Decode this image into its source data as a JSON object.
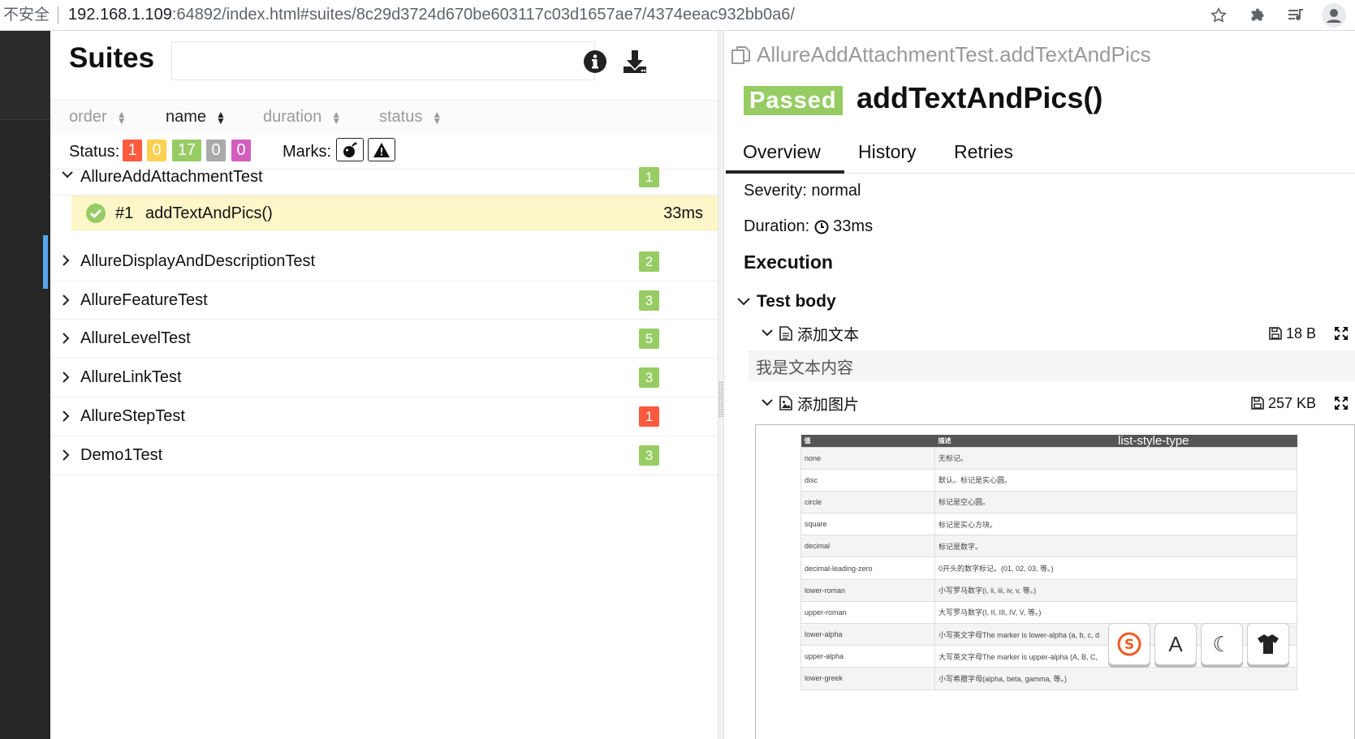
{
  "browser": {
    "insecure_label": "不安全",
    "url_host": "192.168.1.109",
    "url_path": ":64892/index.html#suites/8c29d3724d670be603117c03d1657ae7/4374eeac932bb0a6/"
  },
  "suites": {
    "title": "Suites",
    "search_placeholder": "",
    "sort": {
      "order": "order",
      "name": "name",
      "duration": "duration",
      "status": "status"
    },
    "status_label": "Status:",
    "status_counts": [
      {
        "value": "1",
        "color": "#fd5a3e"
      },
      {
        "value": "0",
        "color": "#ffd050"
      },
      {
        "value": "17",
        "color": "#97cc64"
      },
      {
        "value": "0",
        "color": "#aaaaaa"
      },
      {
        "value": "0",
        "color": "#d35ebe"
      }
    ],
    "marks_label": "Marks:",
    "groups": [
      {
        "name": "AllureAddAttachmentTest",
        "count": "1",
        "color": "#97cc64",
        "expanded": true
      },
      {
        "name": "AllureDisplayAndDescriptionTest",
        "count": "2",
        "color": "#97cc64"
      },
      {
        "name": "AllureFeatureTest",
        "count": "3",
        "color": "#97cc64"
      },
      {
        "name": "AllureLevelTest",
        "count": "5",
        "color": "#97cc64"
      },
      {
        "name": "AllureLinkTest",
        "count": "3",
        "color": "#97cc64"
      },
      {
        "name": "AllureStepTest",
        "count": "1",
        "color": "#fd5a3e"
      },
      {
        "name": "Demo1Test",
        "count": "3",
        "color": "#97cc64"
      }
    ],
    "test": {
      "num": "#1",
      "name": "addTextAndPics()",
      "duration": "33ms"
    }
  },
  "detail": {
    "path": "AllureAddAttachmentTest.addTextAndPics",
    "status": "Passed",
    "title": "addTextAndPics()",
    "tabs": [
      "Overview",
      "History",
      "Retries"
    ],
    "severity": "Severity: normal",
    "duration_label": "Duration:",
    "duration_value": "33ms",
    "execution": "Execution",
    "test_body": "Test body",
    "attachments": [
      {
        "name": "添加文本",
        "size": "18 B",
        "content": "我是文本内容"
      },
      {
        "name": "添加图片",
        "size": "257 KB"
      }
    ],
    "image_table": {
      "header": [
        "值",
        "描述"
      ],
      "caption": "list-style-type",
      "rows": [
        [
          "none",
          "无标记。"
        ],
        [
          "disc",
          "默认。标记是实心圆。"
        ],
        [
          "circle",
          "标记是空心圆。"
        ],
        [
          "square",
          "标记是实心方块。"
        ],
        [
          "decimal",
          "标记是数字。"
        ],
        [
          "decimal-leading-zero",
          "0开头的数字标记。(01, 02, 03, 等。)"
        ],
        [
          "lower-roman",
          "小写罗马数字(i, ii, iii, iv, v, 等。)"
        ],
        [
          "upper-roman",
          "大写罗马数字(I, II, III, IV, V, 等。)"
        ],
        [
          "lower-alpha",
          "小写英文字母The marker is lower-alpha (a, b, c, d"
        ],
        [
          "upper-alpha",
          "大写英文字母The marker is upper-alpha (A, B, C,"
        ],
        [
          "lower-greek",
          "小写希腊字母(alpha, beta, gamma, 等。)"
        ]
      ]
    },
    "float_tools": [
      "S",
      "A",
      "☾",
      "shirt"
    ]
  }
}
